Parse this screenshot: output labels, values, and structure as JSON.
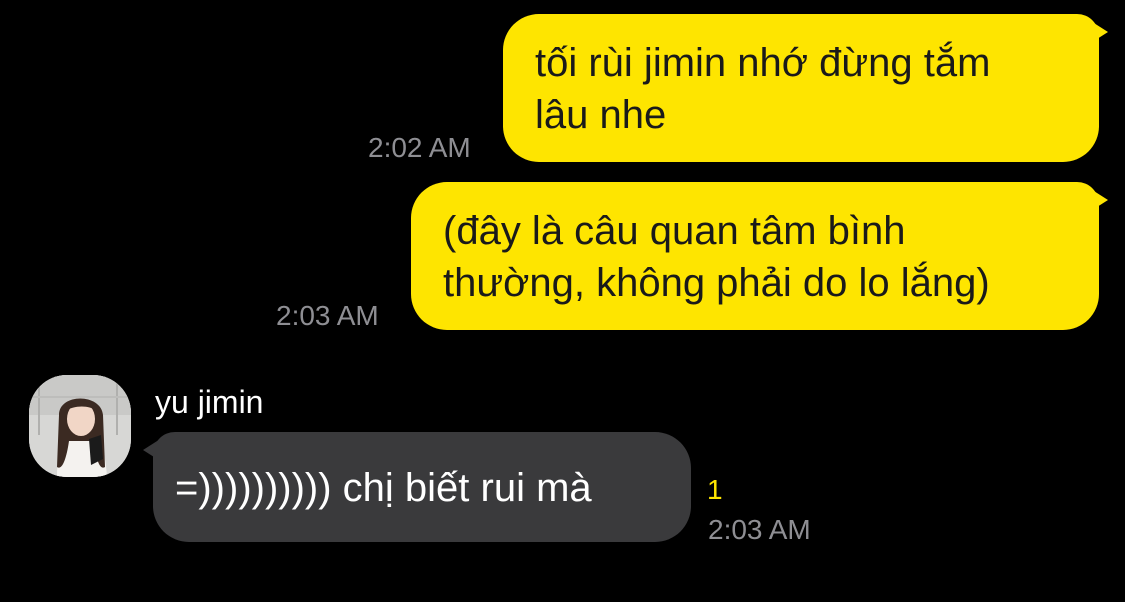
{
  "messages": [
    {
      "direction": "outgoing",
      "text": "tối rùi jimin nhớ đừng tắm\nlâu nhe",
      "time": "2:02 AM"
    },
    {
      "direction": "outgoing",
      "text": "(đây là câu quan tâm bình\nthường, không phải do lo lắng)",
      "time": "2:03 AM"
    },
    {
      "direction": "incoming",
      "sender": "yu jimin",
      "text": "=)))))))))) chị biết rui mà",
      "unread_count": "1",
      "time": "2:03 AM"
    }
  ],
  "colors": {
    "background": "#000000",
    "outgoing_bubble": "#FEE500",
    "incoming_bubble": "#3A3A3C",
    "timestamp": "#8E8E93",
    "unread": "#FEE500"
  }
}
